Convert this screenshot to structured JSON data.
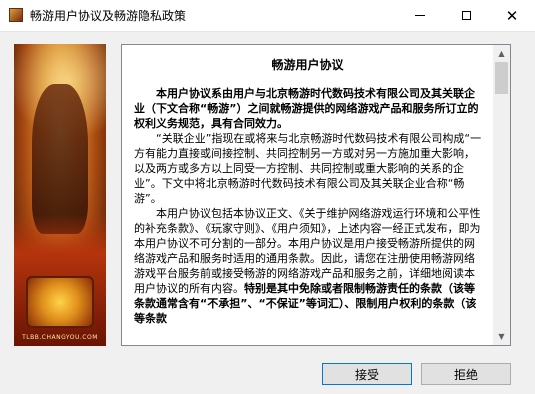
{
  "window": {
    "title": "畅游用户协议及畅游隐私政策",
    "controls": {
      "minimize": "minimize",
      "maximize": "maximize",
      "close": "✕"
    }
  },
  "banner": {
    "logo_text": "TLBB.CHANGYOU.COM",
    "emblem_label": "新天龙八部"
  },
  "document": {
    "heading": "畅游用户协议",
    "paragraphs": [
      "本用户协议系由用户与北京畅游时代数码技术有限公司及其关联企业（下文合称“畅游”）之间就畅游提供的网络游戏产品和服务所订立的权利义务规范，具有合同效力。",
      "“关联企业”指现在或将来与北京畅游时代数码技术有限公司构成“一方有能力直接或间接控制、共同控制另一方或对另一方施加重大影响，以及两方或多方以上同受一方控制、共同控制或重大影响的关系的企业”。下文中将北京畅游时代数码技术有限公司及其关联企业合称“畅游”。",
      "本用户协议包括本协议正文、《关于维护网络游戏运行环境和公平性的补充条款》、《玩家守则》、《用户须知》，上述内容一经正式发布，即为本用户协议不可分割的一部分。本用户协议是用户接受畅游所提供的网络游戏产品和服务时适用的通用条款。因此，请您在注册使用畅游网络游戏平台服务前或接受畅游的网络游戏产品和服务之前，详细地阅读本用户协议的所有内容。",
      "特别是其中免除或者限制畅游责任的条款（该等条款通常含有“不承担”、“不保证”等词汇）、限制用户权利的条款（该等条款"
    ]
  },
  "buttons": {
    "accept": "接受",
    "reject": "拒绝"
  }
}
